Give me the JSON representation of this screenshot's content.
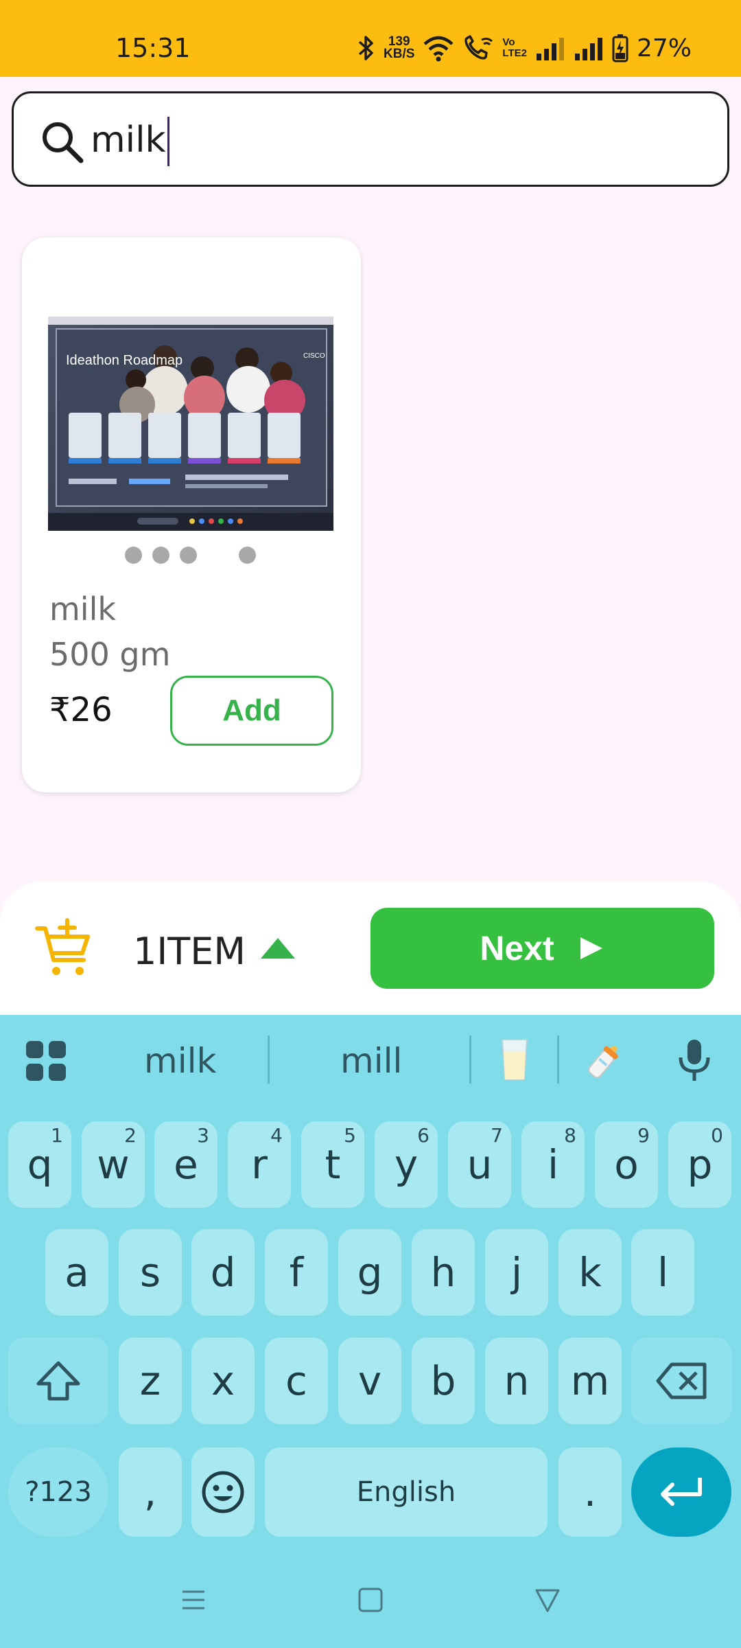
{
  "status_bar": {
    "time": "15:31",
    "net_speed_value": "139",
    "net_speed_unit": "KB/S",
    "volte_top": "Vo",
    "volte_bottom": "LTE2",
    "battery": "27%"
  },
  "search": {
    "query": "milk"
  },
  "product": {
    "name": "milk",
    "quantity": "500 gm",
    "price": "₹26",
    "add_label": "Add",
    "image_text_title": "Ideathon Roadmap",
    "image_text_brand": "CISCO",
    "carousel_dots": 4
  },
  "cart_bar": {
    "item_count": "1ITEM",
    "next_label": "Next"
  },
  "keyboard": {
    "suggestions": [
      "milk",
      "mill"
    ],
    "emoji_suggestions": [
      "glass-of-milk",
      "baby-bottle"
    ],
    "row1": [
      {
        "k": "q",
        "h": "1"
      },
      {
        "k": "w",
        "h": "2"
      },
      {
        "k": "e",
        "h": "3"
      },
      {
        "k": "r",
        "h": "4"
      },
      {
        "k": "t",
        "h": "5"
      },
      {
        "k": "y",
        "h": "6"
      },
      {
        "k": "u",
        "h": "7"
      },
      {
        "k": "i",
        "h": "8"
      },
      {
        "k": "o",
        "h": "9"
      },
      {
        "k": "p",
        "h": "0"
      }
    ],
    "row2": [
      "a",
      "s",
      "d",
      "f",
      "g",
      "h",
      "j",
      "k",
      "l"
    ],
    "row3": [
      "z",
      "x",
      "c",
      "v",
      "b",
      "n",
      "m"
    ],
    "symbols_label": "?123",
    "comma": ",",
    "space_label": "English",
    "period": "."
  },
  "colors": {
    "status_bar_bg": "#fdbd10",
    "accent_green": "#35c03f",
    "keyboard_bg": "#7fdce8",
    "enter_key": "#05a5c2",
    "cart_icon": "#f5b400"
  }
}
